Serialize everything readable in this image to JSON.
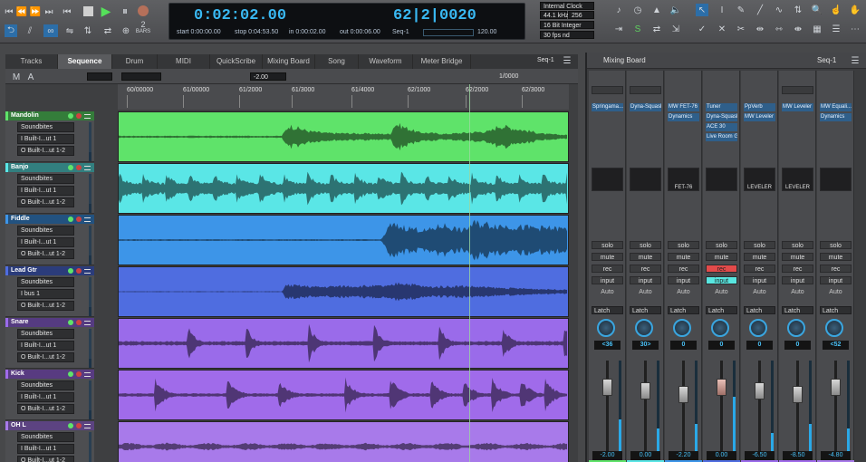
{
  "transport": {
    "time": "0:02:02.00",
    "bars": "62|2|0020",
    "start": "start 0:00:00.00",
    "stop": "stop 0:04:53.50",
    "in_": "in 0:00:02.00",
    "out": "out 0:00:06.00",
    "seq": "Seq-1",
    "tempo": "120.00",
    "bars_label": "BARS"
  },
  "settings": {
    "clock": "Internal Clock",
    "rate": "44.1 kHz",
    "buffer": "256",
    "depth": "16 Bit Integer",
    "fps": "30 fps nd"
  },
  "tabs": [
    "Tracks",
    "Sequence",
    "Drum",
    "MIDI",
    "QuickScribe",
    "Mixing Board",
    "Song",
    "Waveform",
    "Meter Bridge"
  ],
  "seq_name": "Seq-1",
  "seq_toolbar": {
    "m": "M",
    "a": "A",
    "val": "-2.00",
    "ratio": "1/0000"
  },
  "ruler": [
    "60/00000",
    "61/00000",
    "61/2000",
    "61/3000",
    "61/4000",
    "62/1000",
    "62/2000",
    "62/3000"
  ],
  "tracks": [
    {
      "name": "Mandolin",
      "color": "#5fe36a",
      "rows": [
        "Soundbites",
        "I Built-I...ut 1",
        "O Built-I...ut 1-2"
      ]
    },
    {
      "name": "Banjo",
      "color": "#5ae6e6",
      "rows": [
        "Soundbites",
        "I Built-I...ut 1",
        "O Built-I...ut 1-2"
      ]
    },
    {
      "name": "Fiddle",
      "color": "#3d95e8",
      "rows": [
        "Soundbites",
        "I Built-I...ut 1",
        "O Built-I...ut 1-2"
      ]
    },
    {
      "name": "Lead Gtr",
      "color": "#4f6de0",
      "rows": [
        "Soundbites",
        "I bus 1",
        "O Built-I...ut 1-2"
      ]
    },
    {
      "name": "Snare",
      "color": "#9a6bea",
      "rows": [
        "Soundbites",
        "I Built-I...ut 1",
        "O Built-I...ut 1-2"
      ]
    },
    {
      "name": "Kick",
      "color": "#a06bea",
      "rows": [
        "Soundbites",
        "I Built-I...ut 1",
        "O Built-I...ut 1-2"
      ]
    },
    {
      "name": "OH L",
      "color": "#a87aea",
      "rows": [
        "Soundbites",
        "I Built-I...ut 1",
        "O Built-I...ut 1-2"
      ]
    }
  ],
  "mixer": {
    "title": "Mixing Board",
    "seq": "Seq-1",
    "channels": [
      {
        "inserts": [
          "Springama..."
        ],
        "pan": "<36",
        "vol": "-2.00",
        "level": 0.35
      },
      {
        "inserts": [
          "Dyna-Squash"
        ],
        "pan": "30>",
        "vol": "0.00",
        "level": 0.25
      },
      {
        "inserts": [
          "MW FET-76",
          "Dynamics"
        ],
        "pan": "0",
        "vol": "-2.20",
        "level": 0.3
      },
      {
        "inserts": [
          "Tuner",
          "Dyna-Squash",
          "ACE 30",
          "Live Room G"
        ],
        "pan": "0",
        "vol": "0.00",
        "level": 0.6
      },
      {
        "inserts": [
          "PpVerb",
          "MW Leveler"
        ],
        "pan": "0",
        "vol": "-6.50",
        "level": 0.2
      },
      {
        "inserts": [
          "MW Leveler"
        ],
        "pan": "0",
        "vol": "-8.50",
        "level": 0.3
      },
      {
        "inserts": [
          "MW Equali...",
          "Dynamics"
        ],
        "pan": "<52",
        "vol": "-4.80",
        "level": 0.25
      }
    ],
    "buttons": {
      "solo": "solo",
      "mute": "mute",
      "rec": "rec",
      "input": "input",
      "auto": "Auto",
      "latch": "Latch"
    },
    "plugin_labels": [
      "FET-76",
      "LEVELER",
      "LEVELER"
    ]
  }
}
